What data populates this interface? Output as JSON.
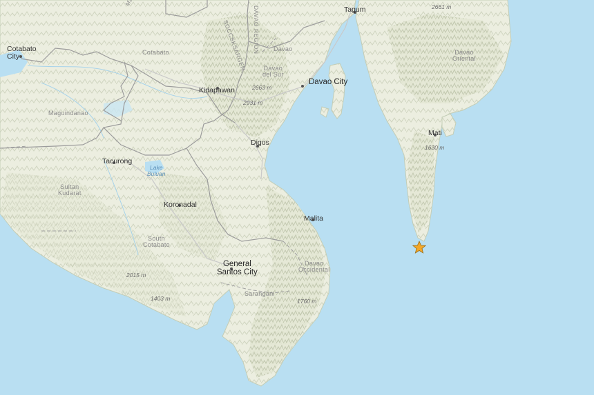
{
  "map": {
    "accent_colors": {
      "water": "#b9dff2",
      "land": "#eef0e3",
      "boundary": "#9c9c9c",
      "epicenter": "#f3a82a"
    },
    "marker": {
      "icon": "star-icon",
      "color": "#f3a82a"
    },
    "labels": {
      "cotabato_city": "Cotabato\nCity",
      "cotabato": "Cotabato",
      "maguindanao": "Maguindanao",
      "tacurong": "Tacurong",
      "lake_buluan": "Lake\nBuluan",
      "sultan_kudarat": "Sultan\nKudarat",
      "koronadal": "Koronadal",
      "south_cotabato": "South\nCotabato",
      "general_santos": "General\nSantos City",
      "sarangani": "Sarangani",
      "kidapawan": "Kidapawan",
      "digos": "Digos",
      "davao_city": "Davao City",
      "davao_del_sur": "Davao\ndel Sur",
      "davao": "Davao",
      "davao_region": "DAVAO REGION",
      "soccsksargen": "SOCCSKSARGEN",
      "tagum": "Tagum",
      "mati": "Mati",
      "davao_oriental": "Davao\nOriental",
      "malita": "Malita",
      "davao_occidental": "Davao\nOccidental",
      "e2661": "2661 m",
      "e2663": "2663 m",
      "e2931": "2931 m",
      "e1630": "1630 m",
      "e2015": "2015 m",
      "e1403": "1403 m",
      "e1760": "1760 m",
      "maguindanao_road": "Maguindanao"
    }
  }
}
